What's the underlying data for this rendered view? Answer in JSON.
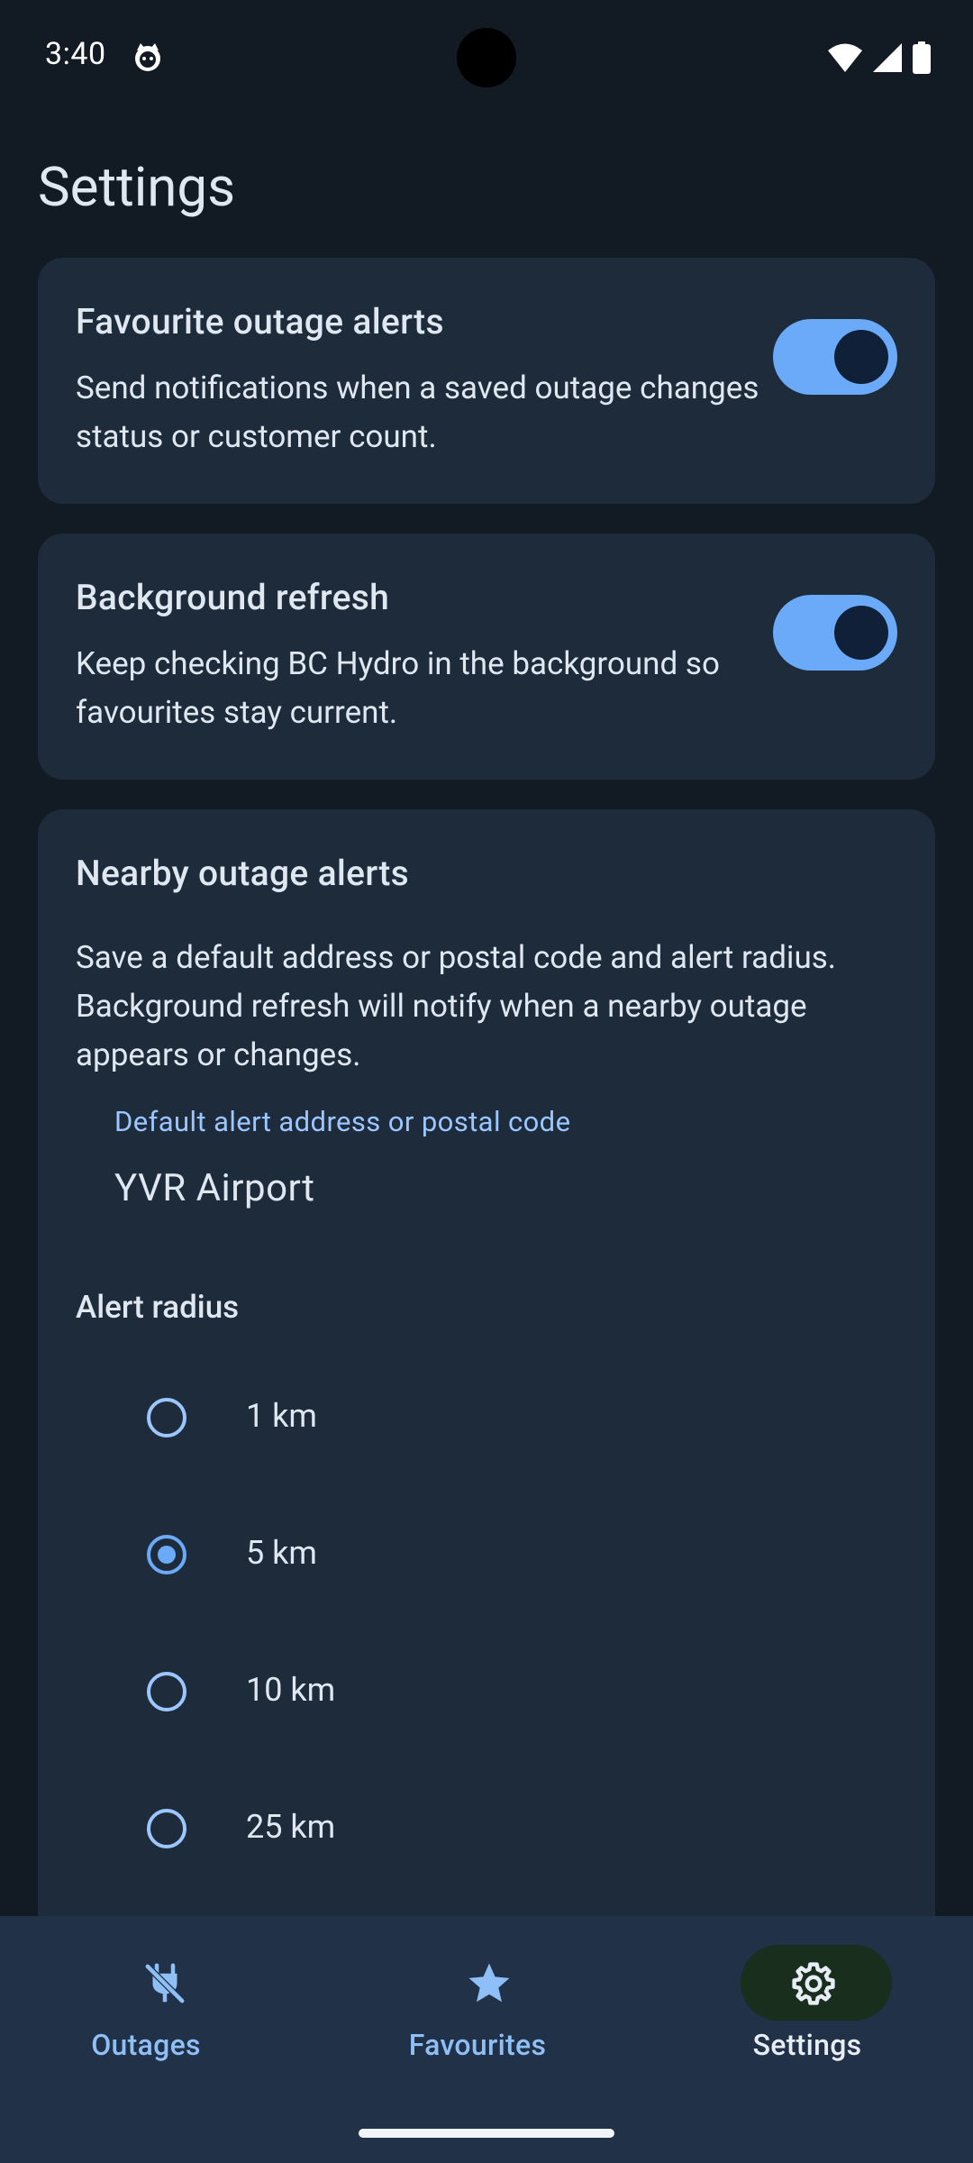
{
  "status_bar": {
    "time": "3:40",
    "app_icon": "cat-face-icon",
    "wifi_icon": "wifi-icon",
    "signal_icon": "cell-signal-icon",
    "battery_icon": "battery-icon"
  },
  "page": {
    "title": "Settings"
  },
  "favourite_alerts": {
    "title": "Favourite outage alerts",
    "description": "Send notifications when a saved outage changes status or customer count.",
    "enabled": true
  },
  "background_refresh": {
    "title": "Background refresh",
    "description": "Keep checking BC Hydro in the background so favourites stay current.",
    "enabled": true
  },
  "nearby_alerts": {
    "title": "Nearby outage alerts",
    "description": "Save a default address or postal code and alert radius. Background refresh will notify when a nearby outage appears or changes.",
    "address_label": "Default alert address or postal code",
    "address_value": "YVR Airport",
    "radius_label": "Alert radius",
    "radius_options": [
      {
        "label": "1 km",
        "selected": false
      },
      {
        "label": "5 km",
        "selected": true
      },
      {
        "label": "10 km",
        "selected": false
      },
      {
        "label": "25 km",
        "selected": false
      }
    ],
    "selected_radius": "5 km"
  },
  "bottom_nav": {
    "items": [
      {
        "label": "Outages",
        "icon": "power-off-plug-icon",
        "active": false
      },
      {
        "label": "Favourites",
        "icon": "star-icon",
        "active": false
      },
      {
        "label": "Settings",
        "icon": "gear-icon",
        "active": true
      }
    ]
  },
  "colors": {
    "background": "#121a24",
    "card": "#1e2b3b",
    "accent": "#6aaaf8",
    "nav_background": "#213148",
    "active_pill": "#192e1c"
  }
}
